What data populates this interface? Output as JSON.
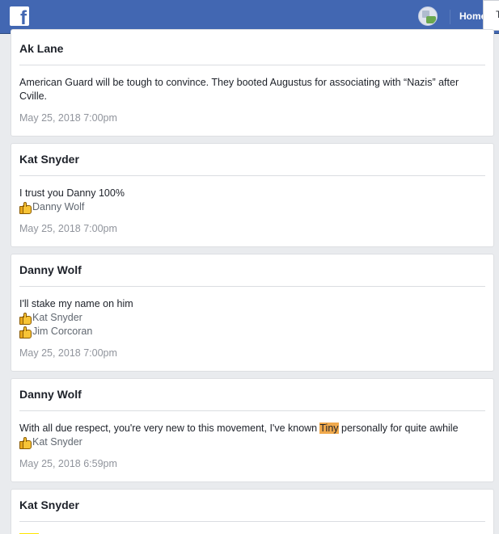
{
  "header": {
    "logo": "f",
    "home_label": "Home",
    "tooltip_text": "T",
    "colors": {
      "bar": "#4267b2",
      "highlight": "#f0a94c"
    }
  },
  "messages": [
    {
      "author": "Ak Lane",
      "text": "American Guard will be tough to convince. They booted Augustus for associating with “Nazis” after Cville.",
      "likes": [],
      "time": "May 25, 2018 7:00pm"
    },
    {
      "author": "Kat Snyder",
      "text": "I trust you Danny 100%",
      "likes": [
        "Danny Wolf"
      ],
      "time": "May 25, 2018 7:00pm"
    },
    {
      "author": "Danny Wolf",
      "text": "I'll stake my name on him",
      "likes": [
        "Kat Snyder",
        "Jim Corcoran"
      ],
      "time": "May 25, 2018 7:00pm"
    },
    {
      "author": "Danny Wolf",
      "text_before": "With all due respect, you're very new to this movement, I've known ",
      "text_highlight": "Tiny",
      "text_after": " personally for quite awhile",
      "likes": [
        "Kat Snyder"
      ],
      "time": "May 25, 2018 6:59pm"
    },
    {
      "author": "Kat Snyder"
    }
  ]
}
